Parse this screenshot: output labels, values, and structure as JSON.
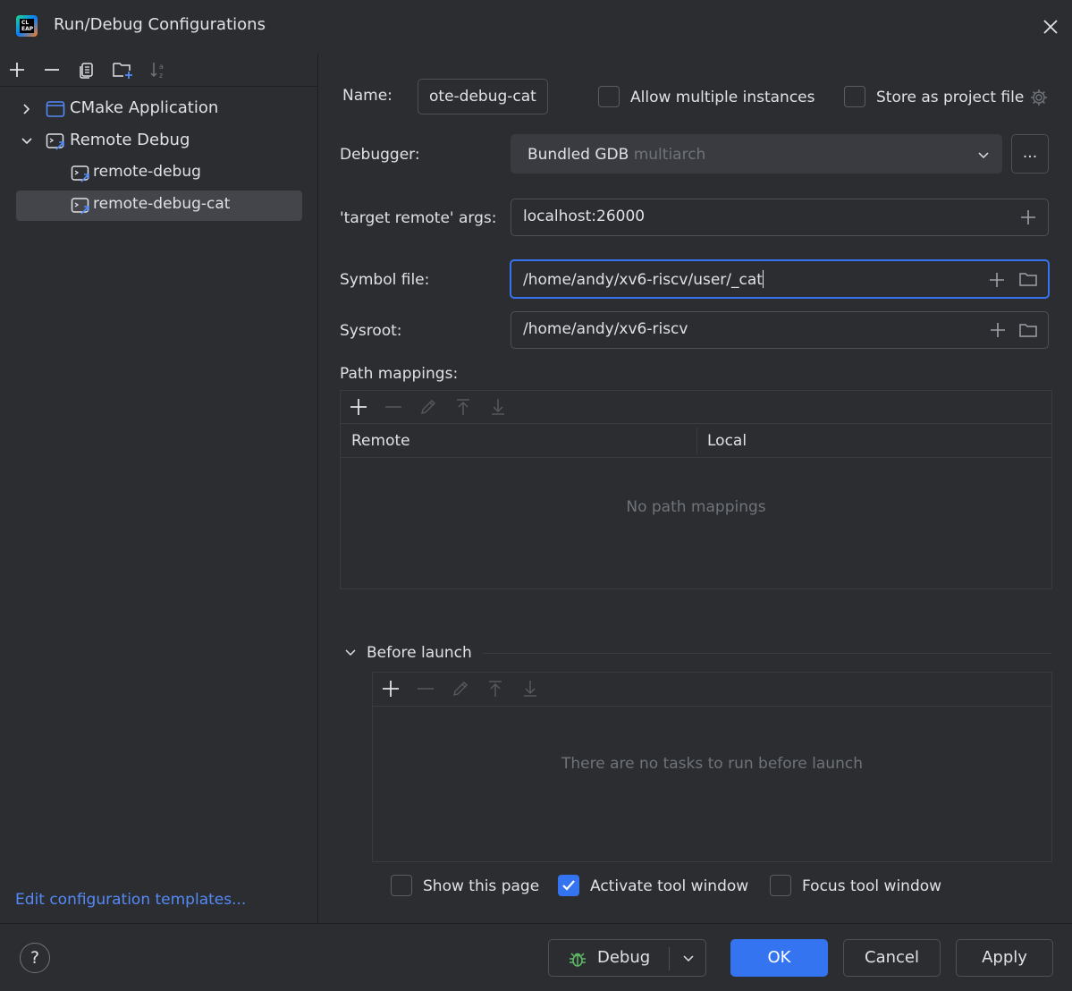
{
  "window": {
    "title": "Run/Debug Configurations",
    "logo_text": "CL EAP"
  },
  "left_toolbar": {
    "icons": [
      "plus-icon",
      "minus-icon",
      "copy-icon",
      "new-folder-icon",
      "sort-icon"
    ]
  },
  "tree": {
    "groups": [
      {
        "label": "CMake Application",
        "expanded": false
      },
      {
        "label": "Remote Debug",
        "expanded": true,
        "children": [
          "remote-debug",
          "remote-debug-cat"
        ]
      }
    ],
    "selected": "remote-debug-cat"
  },
  "edit_templates_link": "Edit configuration templates...",
  "form": {
    "name_label": "Name:",
    "name_value": "ote-debug-cat",
    "allow_multiple_label": "Allow multiple instances",
    "allow_multiple_checked": false,
    "store_project_label": "Store as project file",
    "store_project_checked": false,
    "debugger_label": "Debugger:",
    "debugger_value": "Bundled GDB",
    "debugger_hint": "multiarch",
    "debugger_more": "...",
    "target_remote_label": "'target remote' args:",
    "target_remote_value": "localhost:26000",
    "symbol_file_label": "Symbol file:",
    "symbol_file_value": "/home/andy/xv6-riscv/user/_cat",
    "sysroot_label": "Sysroot:",
    "sysroot_value": "/home/andy/xv6-riscv",
    "path_mappings_label": "Path mappings:",
    "path_mappings_columns": [
      "Remote",
      "Local"
    ],
    "path_mappings_empty": "No path mappings"
  },
  "before_launch": {
    "title": "Before launch",
    "empty_text": "There are no tasks to run before launch",
    "show_page_label": "Show this page",
    "show_page_checked": false,
    "activate_tool_label": "Activate tool window",
    "activate_tool_checked": true,
    "focus_tool_label": "Focus tool window",
    "focus_tool_checked": false
  },
  "footer": {
    "help": "?",
    "debug_label": "Debug",
    "ok_label": "OK",
    "cancel_label": "Cancel",
    "apply_label": "Apply"
  },
  "colors": {
    "accent": "#3574f0",
    "link": "#548af7",
    "background": "#2b2d30",
    "selection": "#43454a"
  }
}
